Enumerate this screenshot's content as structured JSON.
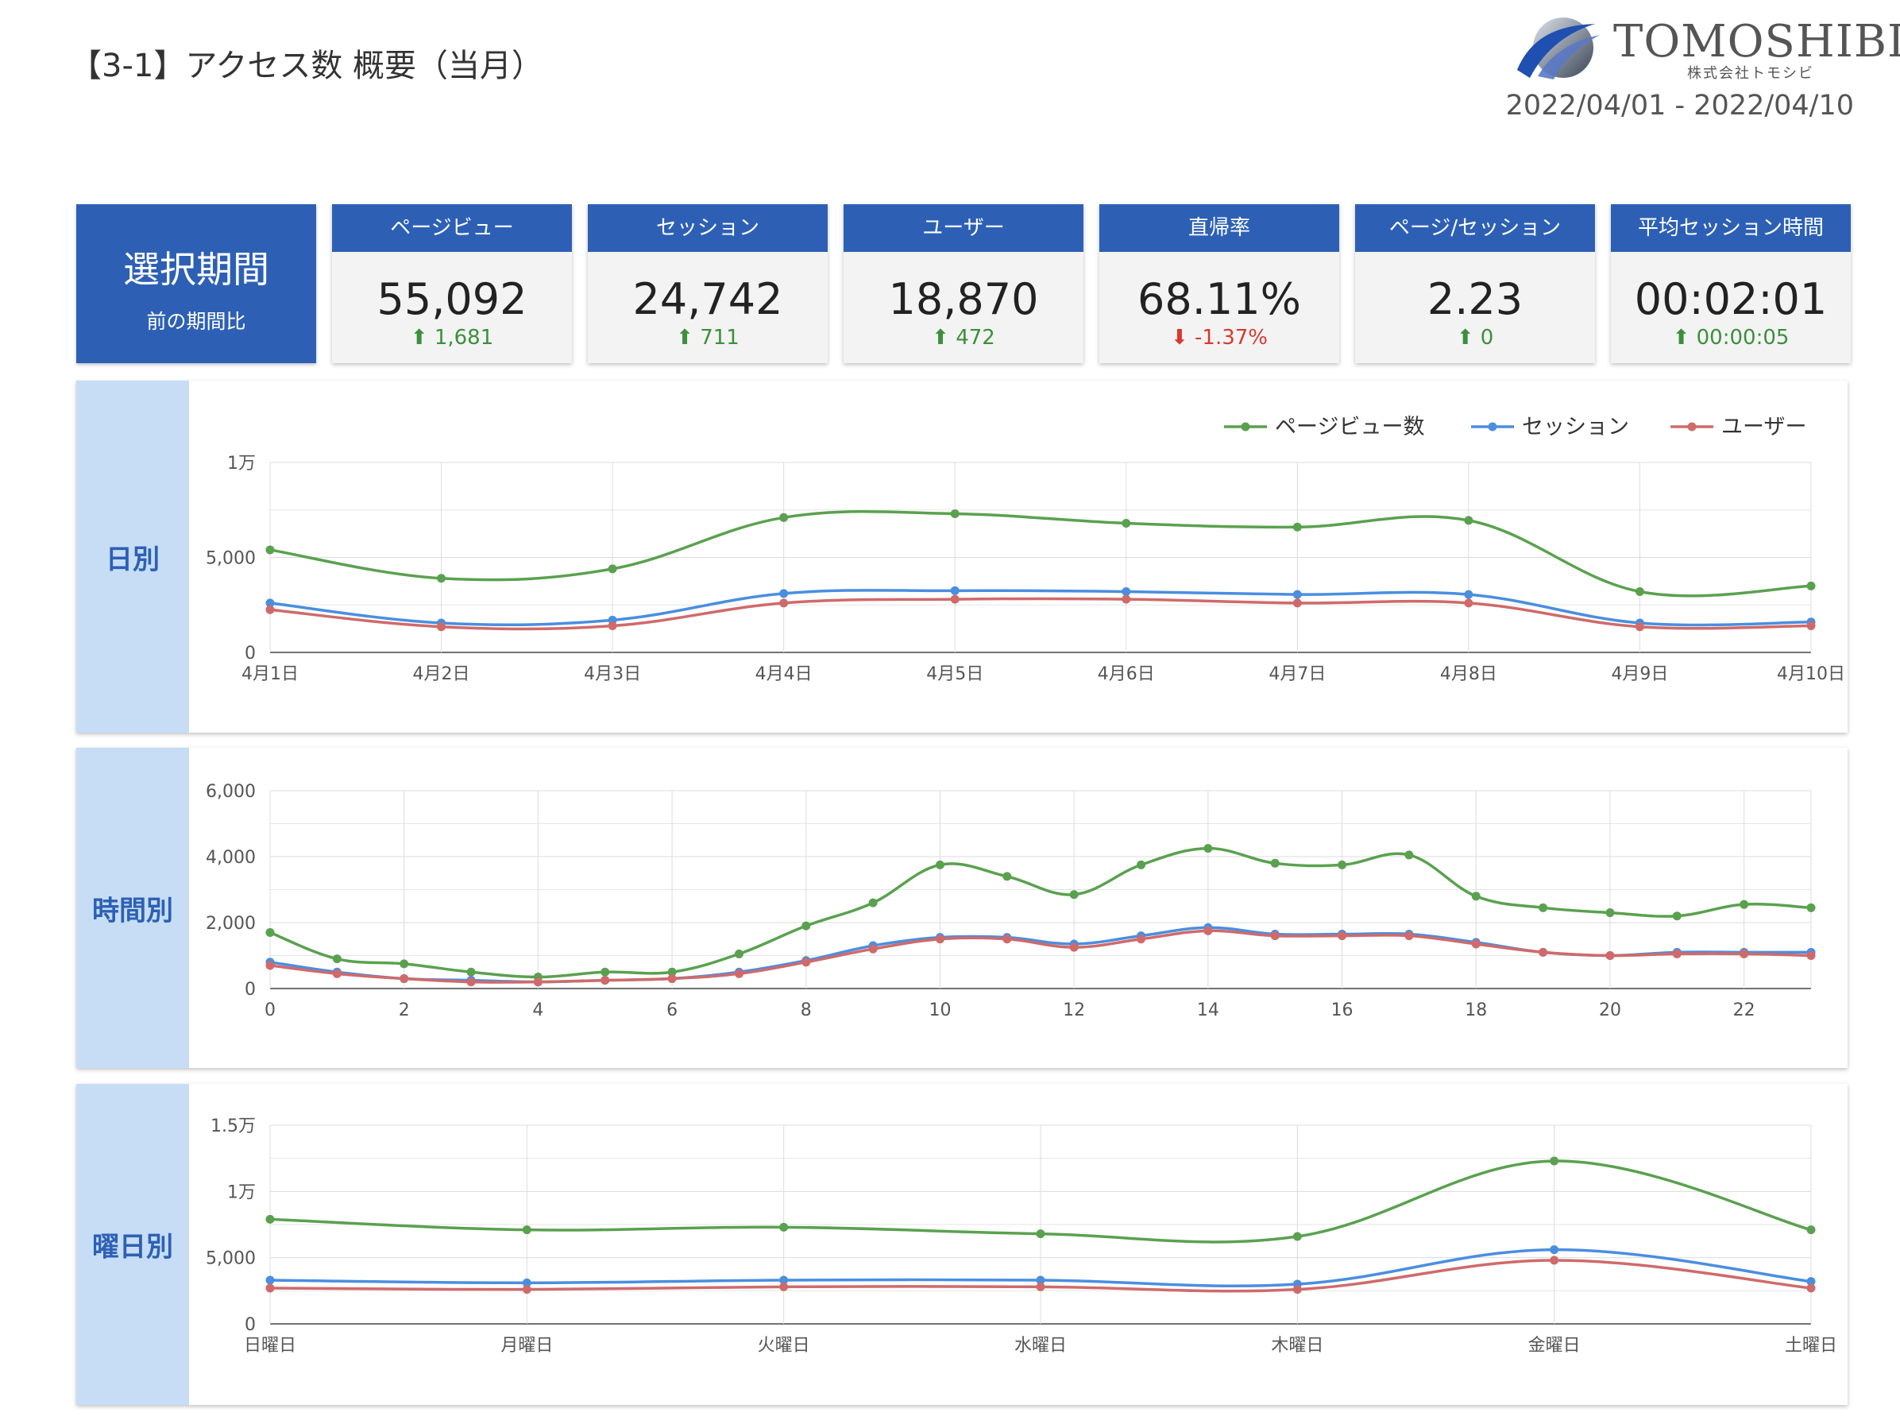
{
  "header": {
    "title": "【3-1】アクセス数 概要（当月）",
    "logo_text": "TOMOSHIBI",
    "logo_sub": "株式会社トモシビ",
    "date_range": "2022/04/01 - 2022/04/10"
  },
  "period": {
    "label": "選択期間",
    "sub": "前の期間比"
  },
  "kpis": [
    {
      "label": "ページビュー",
      "value": "55,092",
      "delta": "1,681",
      "direction": "up"
    },
    {
      "label": "セッション",
      "value": "24,742",
      "delta": "711",
      "direction": "up"
    },
    {
      "label": "ユーザー",
      "value": "18,870",
      "delta": "472",
      "direction": "up"
    },
    {
      "label": "直帰率",
      "value": "68.11%",
      "delta": "-1.37%",
      "direction": "down"
    },
    {
      "label": "ページ/セッション",
      "value": "2.23",
      "delta": "0",
      "direction": "up"
    },
    {
      "label": "平均セッション時間",
      "value": "00:02:01",
      "delta": "00:00:05",
      "direction": "up"
    }
  ],
  "colors": {
    "pageviews": "#5aa14f",
    "sessions": "#4a8ee0",
    "users": "#d06a6a",
    "accent": "#2d60b5",
    "up": "#3c8f3c",
    "down": "#d63a32"
  },
  "panels": {
    "daily": "日別",
    "hourly": "時間別",
    "weekday": "曜日別"
  },
  "chart_data": [
    {
      "type": "line",
      "legend": [
        "ページビュー数",
        "セッション",
        "ユーザー"
      ],
      "legend_position": "top-right",
      "categories": [
        "4月1日",
        "4月2日",
        "4月3日",
        "4月4日",
        "4月5日",
        "4月6日",
        "4月7日",
        "4月8日",
        "4月9日",
        "4月10日"
      ],
      "yticks": [
        0,
        5000,
        10000
      ],
      "ytick_labels": [
        "0",
        "5,000",
        "1万"
      ],
      "ylim": [
        0,
        10000
      ],
      "grid": true,
      "series": [
        {
          "name": "ページビュー数",
          "values": [
            5400,
            3900,
            4400,
            7100,
            7300,
            6800,
            6600,
            6950,
            3200,
            3500
          ]
        },
        {
          "name": "セッション",
          "values": [
            2600,
            1550,
            1700,
            3100,
            3250,
            3200,
            3050,
            3050,
            1550,
            1600
          ]
        },
        {
          "name": "ユーザー",
          "values": [
            2250,
            1350,
            1400,
            2600,
            2800,
            2800,
            2600,
            2600,
            1350,
            1400
          ]
        }
      ]
    },
    {
      "type": "line",
      "x": [
        0,
        1,
        2,
        3,
        4,
        5,
        6,
        7,
        8,
        9,
        10,
        11,
        12,
        13,
        14,
        15,
        16,
        17,
        18,
        19,
        20,
        21,
        22,
        23
      ],
      "xticks": [
        0,
        2,
        4,
        6,
        8,
        10,
        12,
        14,
        16,
        18,
        20,
        22
      ],
      "yticks": [
        0,
        2000,
        4000,
        6000
      ],
      "ytick_labels": [
        "0",
        "2,000",
        "4,000",
        "6,000"
      ],
      "ylim": [
        0,
        6000
      ],
      "grid": true,
      "series": [
        {
          "name": "ページビュー数",
          "values": [
            1700,
            900,
            750,
            500,
            350,
            500,
            500,
            1050,
            1900,
            2600,
            3750,
            3400,
            2850,
            3750,
            4250,
            3800,
            3750,
            4050,
            2800,
            2450,
            2300,
            2200,
            2550,
            2450
          ]
        },
        {
          "name": "セッション",
          "values": [
            800,
            500,
            300,
            250,
            200,
            250,
            300,
            500,
            850,
            1300,
            1550,
            1550,
            1350,
            1600,
            1850,
            1650,
            1650,
            1650,
            1400,
            1100,
            1000,
            1100,
            1100,
            1100
          ]
        },
        {
          "name": "ユーザー",
          "values": [
            700,
            450,
            300,
            200,
            200,
            250,
            300,
            450,
            800,
            1200,
            1500,
            1500,
            1250,
            1500,
            1750,
            1600,
            1600,
            1600,
            1350,
            1100,
            1000,
            1050,
            1050,
            1000
          ]
        }
      ]
    },
    {
      "type": "line",
      "categories": [
        "日曜日",
        "月曜日",
        "火曜日",
        "水曜日",
        "木曜日",
        "金曜日",
        "土曜日"
      ],
      "yticks": [
        0,
        5000,
        10000,
        15000
      ],
      "ytick_labels": [
        "0",
        "5,000",
        "1万",
        "1.5万"
      ],
      "ylim": [
        0,
        15000
      ],
      "grid": true,
      "series": [
        {
          "name": "ページビュー数",
          "values": [
            7900,
            7100,
            7300,
            6800,
            6600,
            12300,
            7100
          ]
        },
        {
          "name": "セッション",
          "values": [
            3300,
            3100,
            3300,
            3300,
            3000,
            5600,
            3200
          ]
        },
        {
          "name": "ユーザー",
          "values": [
            2700,
            2600,
            2800,
            2800,
            2600,
            4800,
            2700
          ]
        }
      ]
    }
  ]
}
